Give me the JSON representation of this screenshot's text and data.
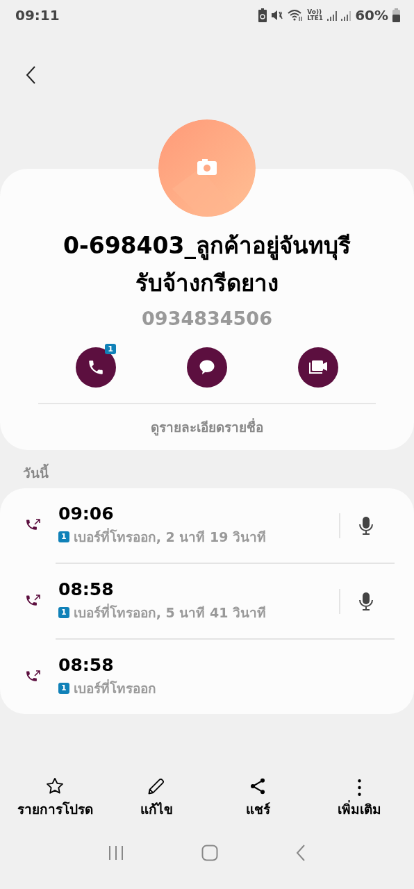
{
  "status_bar": {
    "time": "09:11",
    "volte_label": "Vo))",
    "lte_label": "LTE1",
    "battery": "60%"
  },
  "contact": {
    "name_lines": [
      "0-698403_ลูกค้าอยู่จันทบุรี",
      "รับจ้างกรีดยาง"
    ],
    "phone": "0934834506",
    "actions": [
      {
        "kind": "call",
        "badge": "1"
      },
      {
        "kind": "message"
      },
      {
        "kind": "video"
      }
    ],
    "details_link": "ดูรายละเอียดรายชื่อ"
  },
  "section_label": "วันนี้",
  "calls": [
    {
      "time": "09:06",
      "sim": "1",
      "detail": "เบอร์ที่โทรออก, 2 นาที 19 วินาที",
      "recording": true
    },
    {
      "time": "08:58",
      "sim": "1",
      "detail": "เบอร์ที่โทรออก, 5 นาที 41 วินาที",
      "recording": true
    },
    {
      "time": "08:58",
      "sim": "1",
      "detail": "เบอร์ที่โทรออก",
      "recording": false
    }
  ],
  "bottom_actions": [
    {
      "kind": "favorite",
      "label": "รายการโปรด"
    },
    {
      "kind": "edit",
      "label": "แก้ไข"
    },
    {
      "kind": "share",
      "label": "แชร์"
    },
    {
      "kind": "more",
      "label": "เพิ่มเติม"
    }
  ]
}
